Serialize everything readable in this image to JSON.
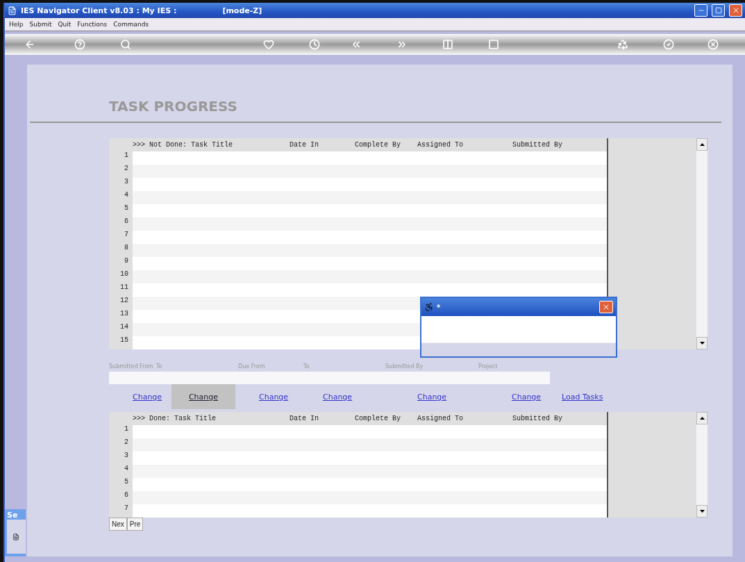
{
  "window": {
    "title": "IES Navigator Client v8.03 : My IES :",
    "mode": "[mode-Z]"
  },
  "menu": [
    "Help",
    "Submit",
    "Quit",
    "Functions",
    "Commands"
  ],
  "page_title": "TASK PROGRESS",
  "tables": [
    {
      "columns": [
        ">>> Not Done: Task Title",
        "Date In",
        "Complete By",
        "Assigned To",
        "Submitted By"
      ],
      "row_numbers": [
        "1",
        "2",
        "3",
        "4",
        "5",
        "6",
        "7",
        "8",
        "9",
        "10",
        "11",
        "12",
        "13",
        "14",
        "15"
      ]
    },
    {
      "columns": [
        ">>> Done: Task Title",
        "Date In",
        "Complete By",
        "Assigned To",
        "Submitted By"
      ],
      "row_numbers": [
        "1",
        "2",
        "3",
        "4",
        "5",
        "6",
        "7"
      ]
    }
  ],
  "filters": [
    "Submitted From",
    "To",
    "Due From",
    "To",
    "Submitted By",
    "Project"
  ],
  "links": [
    {
      "label": "Change",
      "selected": false
    },
    {
      "label": "Change",
      "selected": true
    },
    {
      "label": "Change",
      "selected": false
    },
    {
      "label": "Change",
      "selected": false
    },
    {
      "label": "Change",
      "selected": false
    },
    {
      "label": "Change",
      "selected": false
    },
    {
      "label": "Load Tasks",
      "selected": false
    }
  ],
  "pager": [
    "Nex",
    "Pre"
  ],
  "dialog": {
    "title": "*"
  },
  "side_window": {
    "title": "Se"
  }
}
